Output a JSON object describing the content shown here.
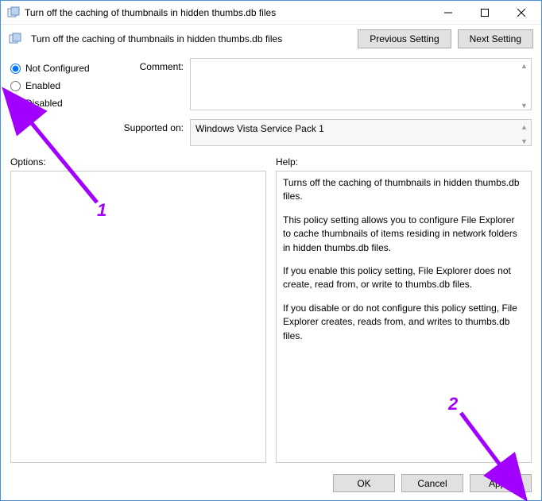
{
  "titlebar": {
    "title": "Turn off the caching of thumbnails in hidden thumbs.db files"
  },
  "toolbar": {
    "title": "Turn off the caching of thumbnails in hidden thumbs.db files",
    "prev_label": "Previous Setting",
    "next_label": "Next Setting"
  },
  "radios": {
    "not_configured": "Not Configured",
    "enabled": "Enabled",
    "disabled": "Disabled",
    "selected": "not_configured"
  },
  "fields": {
    "comment_label": "Comment:",
    "comment_value": "",
    "supported_label": "Supported on:",
    "supported_value": "Windows Vista Service Pack 1"
  },
  "panes": {
    "options_label": "Options:",
    "help_label": "Help:",
    "help_text": {
      "p1": "Turns off the caching of thumbnails in hidden thumbs.db files.",
      "p2": "This policy setting allows you to configure File Explorer to cache thumbnails of items residing in network folders in hidden thumbs.db files.",
      "p3": "If you enable this policy setting, File Explorer does not create, read from, or write to thumbs.db files.",
      "p4": "If you disable or do not configure this policy setting, File Explorer creates, reads from, and writes to thumbs.db files."
    }
  },
  "footer": {
    "ok": "OK",
    "cancel": "Cancel",
    "apply": "Apply"
  },
  "annotations": {
    "num1": "1",
    "num2": "2"
  }
}
